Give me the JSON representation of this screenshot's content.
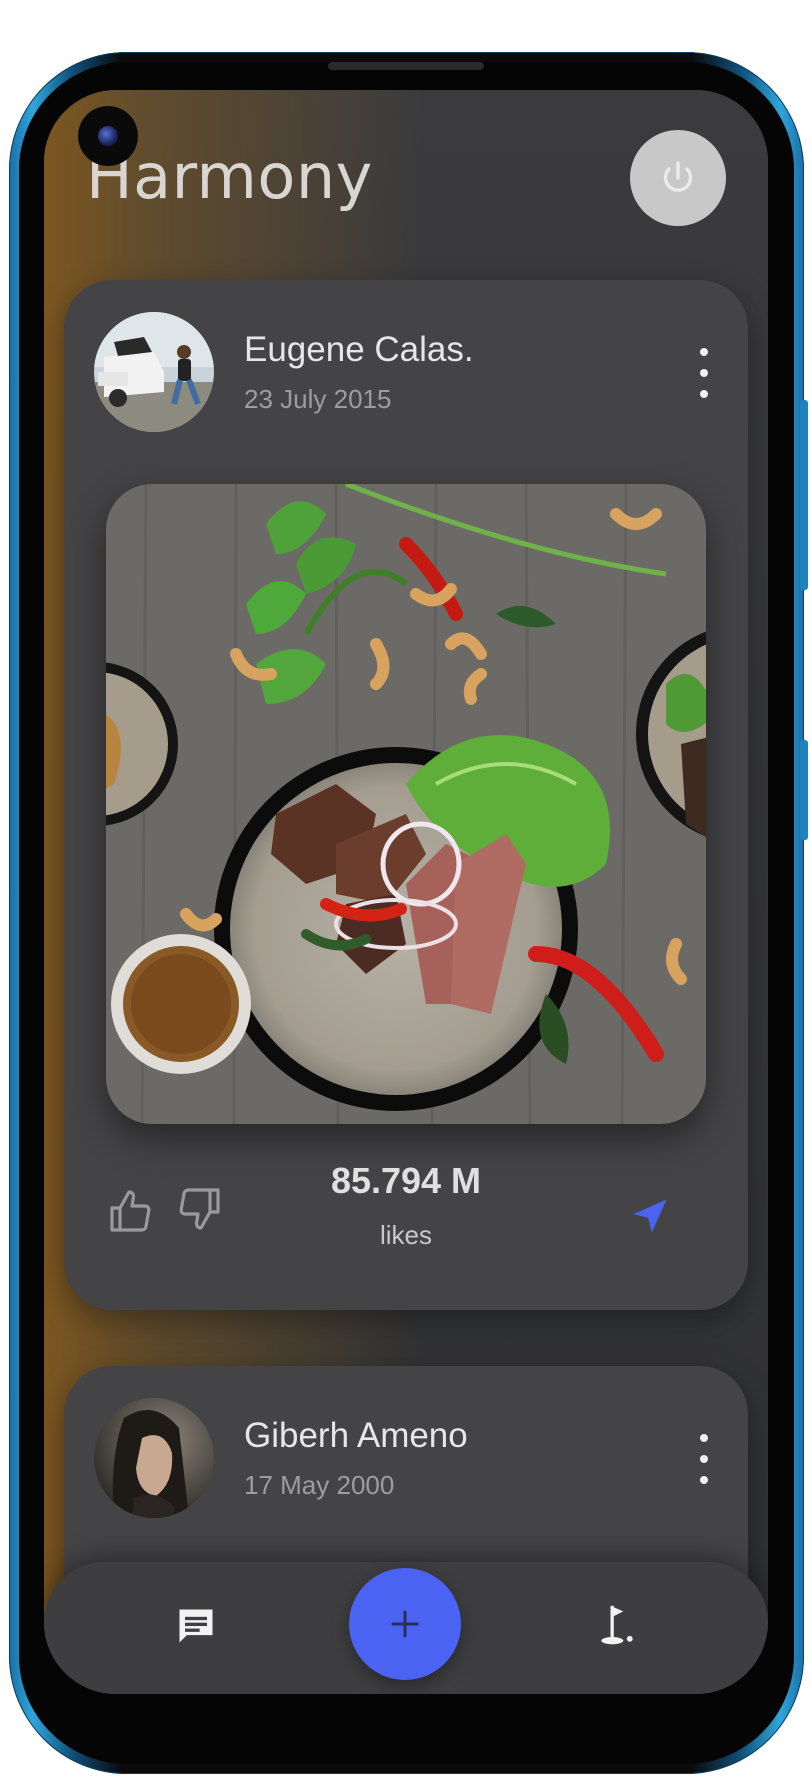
{
  "app": {
    "title": "Harmony"
  },
  "posts": [
    {
      "author": "Eugene Calas.",
      "date": "23 July 2015",
      "likes_count": "85.794 M",
      "likes_label": "likes"
    },
    {
      "author": "Giberh Ameno",
      "date": "17 May 2000"
    }
  ],
  "icons": {
    "power": "power-icon",
    "more": "more-vertical-icon",
    "like": "thumbs-up-icon",
    "dislike": "thumbs-down-icon",
    "send": "navigation-send-icon",
    "chat": "chat-message-icon",
    "add": "plus-icon",
    "golf": "golf-flag-icon"
  },
  "colors": {
    "accent": "#4a63f2",
    "card": "#444446",
    "background": "#3a3a3c",
    "gradient_warm": "#80581e"
  }
}
